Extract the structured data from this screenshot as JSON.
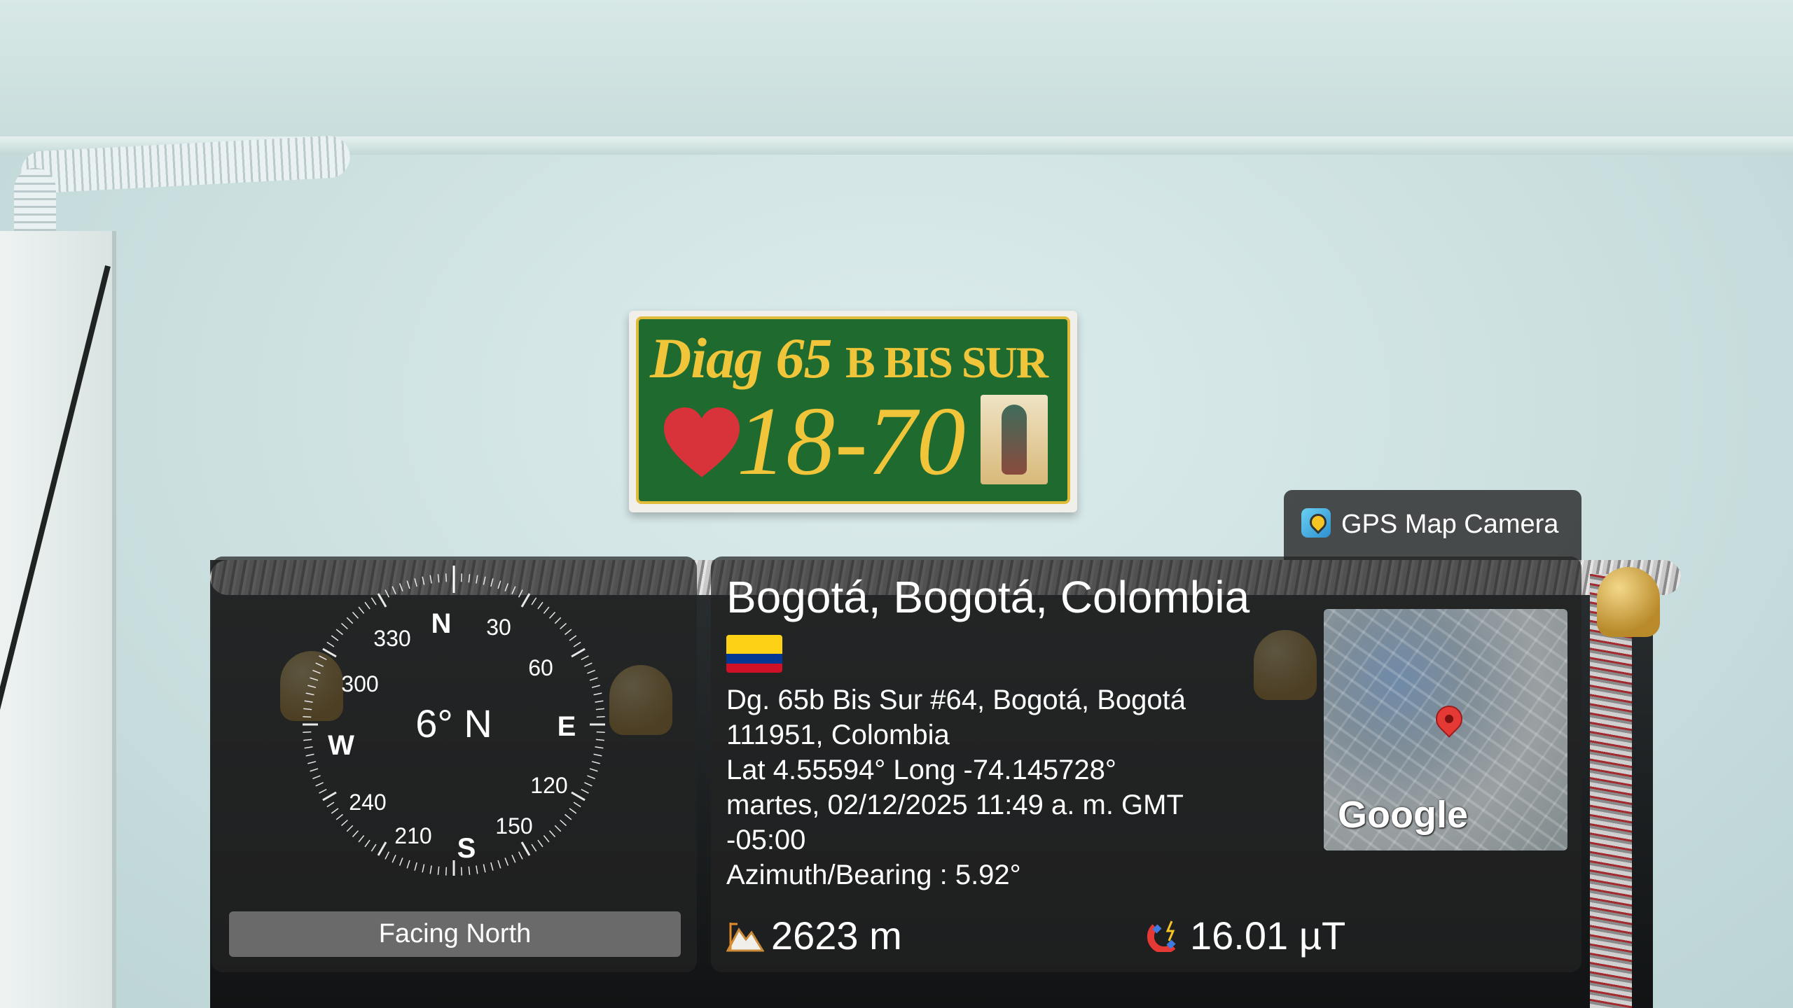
{
  "plate": {
    "street_script": "Diag",
    "street_number": "65",
    "street_suffix": "B BIS SUR",
    "house_number": "18-70"
  },
  "brand": {
    "label": "GPS Map Camera",
    "icon": "gps-map-camera-app-icon"
  },
  "compass": {
    "heading_text": "6° N",
    "cardinals": {
      "north": "N",
      "east": "E",
      "south": "S",
      "west": "W"
    },
    "degree_labels": [
      "30",
      "60",
      "120",
      "150",
      "210",
      "240",
      "300",
      "330"
    ],
    "facing_label": "Facing North"
  },
  "location": {
    "title": "Bogotá, Bogotá, Colombia",
    "flag_icon": "colombia-flag-icon",
    "address_line1": "Dg. 65b Bis Sur #64, Bogotá, Bogotá",
    "address_line2": "111951, Colombia",
    "coordinates": "Lat 4.55594° Long -74.145728°",
    "datetime_line1": "martes, 02/12/2025 11:49 a. m. GMT",
    "datetime_line2": "-05:00",
    "azimuth": "Azimuth/Bearing : 5.92°"
  },
  "map": {
    "logo": "Google",
    "pin_icon": "map-pin-icon"
  },
  "stats": {
    "altitude": "2623 m",
    "altitude_icon": "mountain-icon",
    "magnetic_field": "16.01 µT",
    "magnet_icon": "magnet-icon"
  },
  "colors": {
    "panel_bg": "#222222",
    "plate_green": "#1f6a2f",
    "plate_gold": "#f1c53a",
    "pin_red": "#e53935"
  }
}
